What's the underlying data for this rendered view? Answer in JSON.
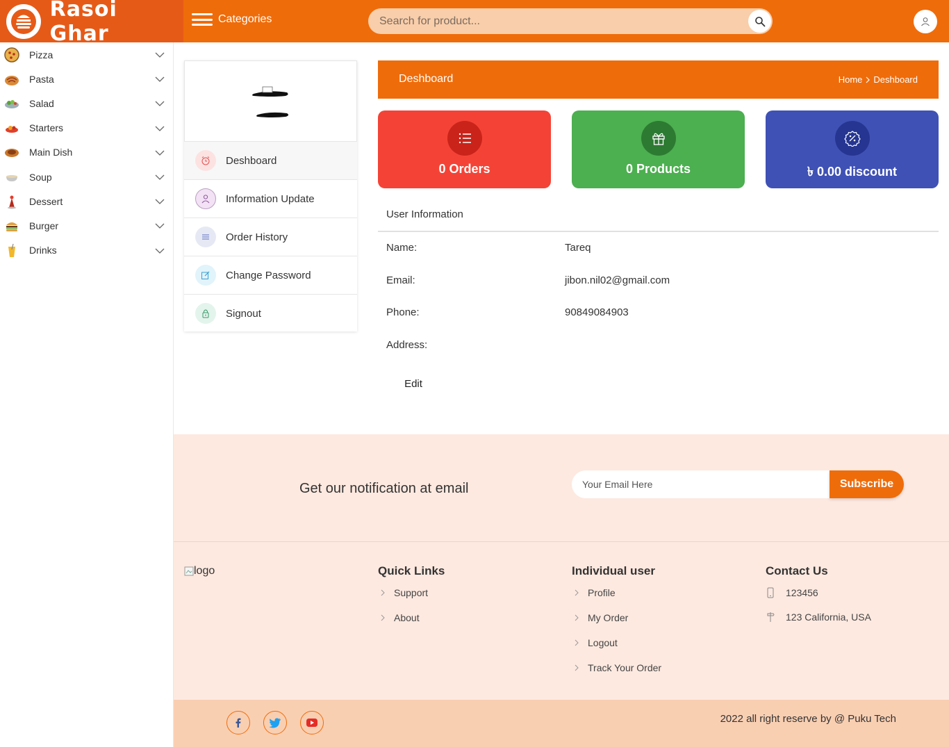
{
  "header": {
    "brand_name": "Rasoi Ghar",
    "categories_label": "Categories",
    "search_placeholder": "Search for product..."
  },
  "sidebar": {
    "items": [
      {
        "label": "Pizza",
        "icon": "pizza-icon"
      },
      {
        "label": "Pasta",
        "icon": "pasta-icon"
      },
      {
        "label": "Salad",
        "icon": "salad-icon"
      },
      {
        "label": "Starters",
        "icon": "starters-icon"
      },
      {
        "label": "Main Dish",
        "icon": "main-dish-icon"
      },
      {
        "label": "Soup",
        "icon": "soup-icon"
      },
      {
        "label": "Dessert",
        "icon": "dessert-icon"
      },
      {
        "label": "Burger",
        "icon": "burger-icon"
      },
      {
        "label": "Drinks",
        "icon": "drinks-icon"
      }
    ]
  },
  "account_menu": {
    "items": [
      {
        "label": "Deshboard",
        "icon": "alarm-clock-icon"
      },
      {
        "label": "Information Update",
        "icon": "user-icon"
      },
      {
        "label": "Order History",
        "icon": "list-icon"
      },
      {
        "label": "Change Password",
        "icon": "edit-icon"
      },
      {
        "label": "Signout",
        "icon": "lock-icon"
      }
    ]
  },
  "dashboard": {
    "title": "Deshboard",
    "breadcrumb_home": "Home",
    "breadcrumb_current": "Deshboard",
    "stats": [
      {
        "text": "0 Orders",
        "color": "#f44336",
        "icon": "list-icon"
      },
      {
        "text": "0 Products",
        "color": "#4caf50",
        "icon": "gift-icon"
      },
      {
        "text": "৳ 0.00 discount",
        "color": "#3f51b5",
        "icon": "discount-badge-icon"
      }
    ],
    "user_info_title": "User Information",
    "fields": [
      {
        "label": "Name:",
        "value": "Tareq"
      },
      {
        "label": "Email:",
        "value": "jibon.nil02@gmail.com"
      },
      {
        "label": "Phone:",
        "value": "90849084903"
      },
      {
        "label": "Address:",
        "value": ""
      }
    ],
    "edit_label": "Edit"
  },
  "newsletter": {
    "title": "Get our notification at email",
    "email_placeholder": "Your Email Here",
    "subscribe_label": "Subscribe"
  },
  "footer": {
    "logo_alt": "logo",
    "quick_links": {
      "title": "Quick Links",
      "items": [
        "Support",
        "About"
      ]
    },
    "individual_user": {
      "title": "Individual user",
      "items": [
        "Profile",
        "My Order",
        "Logout",
        "Track Your Order"
      ]
    },
    "contact": {
      "title": "Contact Us",
      "phone": "123456",
      "address": "123 California, USA"
    },
    "copyright": "2022 all right reserve by @ Puku Tech"
  },
  "colors": {
    "brand_orange": "#ef6c0a",
    "footer_bg": "#fde9e0",
    "bottom_bar_bg": "#f9cfb2"
  }
}
